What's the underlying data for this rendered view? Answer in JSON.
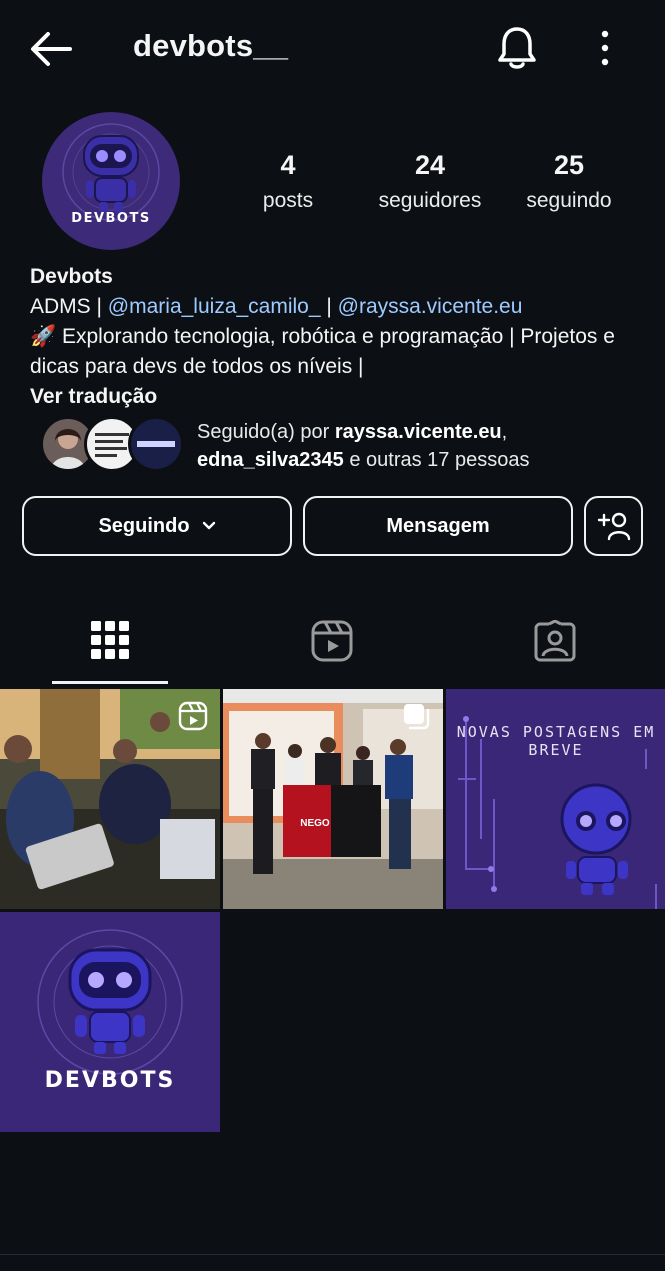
{
  "header": {
    "username": "devbots__",
    "back_icon": "arrow-left-icon",
    "notifications_icon": "bell-icon",
    "menu_icon": "more-vertical-icon"
  },
  "profile": {
    "avatar_text": "DEVBOTS",
    "stats": {
      "posts_count": "4",
      "posts_label": "posts",
      "followers_count": "24",
      "followers_label": "seguidores",
      "following_count": "25",
      "following_label": "seguindo"
    },
    "bio": {
      "name": "Devbots",
      "line_prefix": "ADMS | ",
      "mention_1": "@maria_luiza_camilo_",
      "separator": " | ",
      "mention_2": "@rayssa.vicente.eu",
      "description": "🚀 Explorando tecnologia, robótica e programação | Projetos e dicas para devs de todos os níveis |",
      "translate": "Ver tradução"
    },
    "followed_by": {
      "prefix": "Seguido(a) por ",
      "user_1": "rayssa.vicente.eu",
      "comma": ",",
      "user_2": "edna_silva2345",
      "suffix": " e outras 17 pessoas"
    }
  },
  "actions": {
    "following_label": "Seguindo",
    "message_label": "Mensagem",
    "add_user_icon": "person-add-icon"
  },
  "tabs": [
    {
      "name": "posts-grid",
      "icon": "grid-icon",
      "active": true
    },
    {
      "name": "reels",
      "icon": "reels-icon",
      "active": false
    },
    {
      "name": "tagged",
      "icon": "tagged-person-icon",
      "active": false
    }
  ],
  "posts": [
    {
      "kind": "reel",
      "badge_icon": "reels-icon"
    },
    {
      "kind": "carousel",
      "badge_icon": "carousel-icon",
      "flag_text": "NEGO"
    },
    {
      "kind": "image",
      "text": "NOVAS POSTAGENS EM BREVE"
    },
    {
      "kind": "image",
      "text": "DEVBOTS"
    }
  ],
  "colors": {
    "background": "#0c0f14",
    "link": "#9ecbff",
    "brand_purple": "#3a2777"
  }
}
